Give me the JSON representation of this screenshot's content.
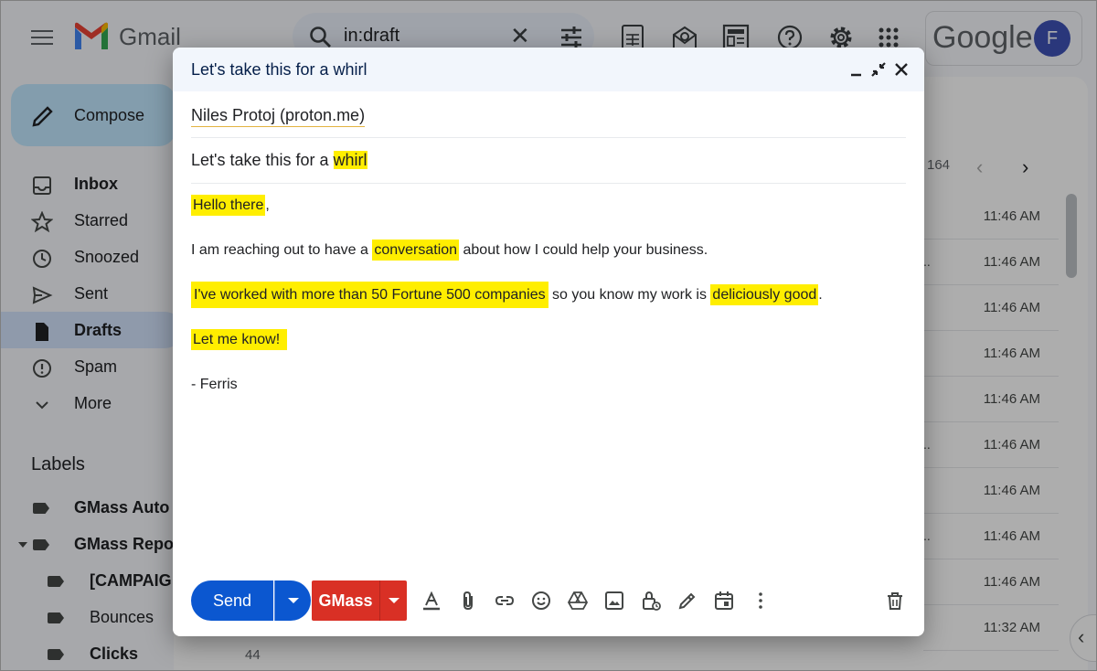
{
  "app": {
    "name": "Gmail",
    "search_query": "in:draft",
    "google_label": "Google",
    "avatar_initial": "F"
  },
  "sidebar": {
    "compose_label": "Compose",
    "items": [
      {
        "label": "Inbox",
        "icon": "inbox-icon",
        "bold": true
      },
      {
        "label": "Starred",
        "icon": "star-icon"
      },
      {
        "label": "Snoozed",
        "icon": "clock-icon"
      },
      {
        "label": "Sent",
        "icon": "send-icon"
      },
      {
        "label": "Drafts",
        "icon": "draft-icon",
        "active": true
      },
      {
        "label": "Spam",
        "icon": "spam-icon"
      },
      {
        "label": "More",
        "icon": "chevron-down-icon"
      }
    ],
    "labels_title": "Labels",
    "labels": [
      {
        "label": "GMass Auto",
        "bold": true
      },
      {
        "label": "GMass Repo",
        "bold": true
      },
      {
        "label": "[CAMPAIG",
        "bold": true
      },
      {
        "label": "Bounces"
      },
      {
        "label": "Clicks",
        "bold": true,
        "count": "44"
      }
    ]
  },
  "list": {
    "count_text": "164",
    "rows": [
      {
        "snippet": "",
        "time": "11:46 AM"
      },
      {
        "snippet": "..",
        "time": "11:46 AM"
      },
      {
        "snippet": "",
        "time": "11:46 AM"
      },
      {
        "snippet": "",
        "time": "11:46 AM"
      },
      {
        "snippet": "",
        "time": "11:46 AM"
      },
      {
        "snippet": "..",
        "time": "11:46 AM"
      },
      {
        "snippet": "",
        "time": "11:46 AM"
      },
      {
        "snippet": "..",
        "time": "11:46 AM"
      },
      {
        "snippet": "",
        "time": "11:46 AM"
      },
      {
        "snippet": "",
        "time": "11:32 AM"
      }
    ]
  },
  "compose": {
    "title": "Let's take this for a whirl",
    "to": "Niles Protoj (proton.me)",
    "subject_prefix": "Let's take this for a ",
    "subject_highlight": "whirl",
    "body": {
      "greeting_hl": "Hello there",
      "greeting_tail": ",",
      "p1_a": "I am reaching out to have a ",
      "p1_hl": "conversation",
      "p1_b": " about how I could help your business.",
      "p2_hl1": "I've worked with more than 50 Fortune 500 companies",
      "p2_mid": " so you know my work is ",
      "p2_hl2": "deliciously good",
      "p2_end": ".",
      "p3_hl": "Let me know!",
      "signature": "- Ferris"
    },
    "send_label": "Send",
    "gmass_label": "GMass"
  },
  "colors": {
    "highlight": "#ffee00",
    "send": "#0b57d0",
    "gmass": "#d93025",
    "drafts_active": "#d3e3fd"
  }
}
